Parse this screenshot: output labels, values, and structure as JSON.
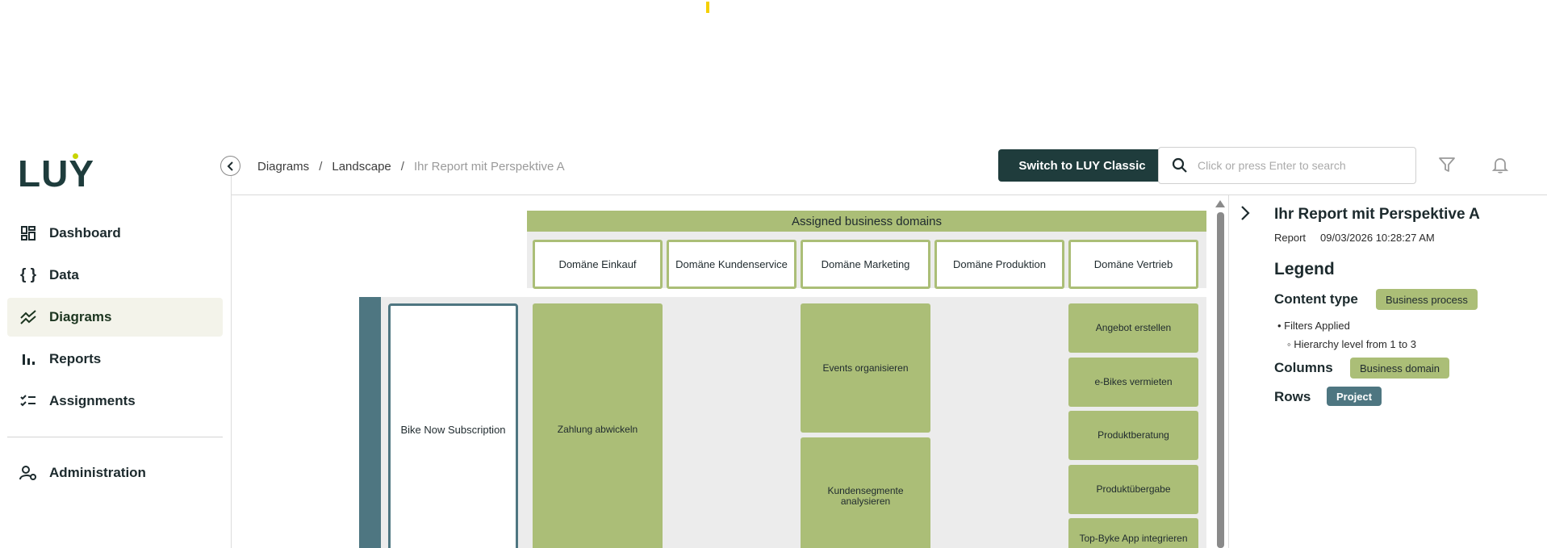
{
  "app": {
    "logo": "LUY",
    "accent": "#1f3c3c",
    "logo_dot_color": "#c8d400"
  },
  "sidebar": {
    "items": [
      {
        "label": "Dashboard",
        "icon": "dashboard-grid-icon",
        "active": false
      },
      {
        "label": "Data",
        "icon": "curly-braces-icon",
        "active": false
      },
      {
        "label": "Diagrams",
        "icon": "trend-chart-icon",
        "active": true
      },
      {
        "label": "Reports",
        "icon": "bar-chart-icon",
        "active": false
      },
      {
        "label": "Assignments",
        "icon": "checklist-icon",
        "active": false
      },
      {
        "label": "Administration",
        "icon": "user-settings-icon",
        "active": false
      }
    ]
  },
  "header": {
    "breadcrumb": [
      "Diagrams",
      "Landscape",
      "Ihr Report mit Perspektive A"
    ],
    "switch_label": "Switch to LUY Classic",
    "search_placeholder": "Click or press Enter to search"
  },
  "diagram": {
    "title": "Assigned business domains",
    "columns": [
      "Domäne Einkauf",
      "Domäne Kundenservice",
      "Domäne Marketing",
      "Domäne Produktion",
      "Domäne Vertrieb"
    ],
    "rows": [
      {
        "label": "Bike Now Subscription",
        "cells": [
          [
            "Zahlung abwickeln"
          ],
          [],
          [
            "Events organisieren",
            "Kundensegmente analysieren"
          ],
          [],
          [
            "Angebot erstellen",
            "e-Bikes vermieten",
            "Produktberatung",
            "Produktübergabe",
            "Top-Byke App integrieren"
          ]
        ]
      }
    ],
    "colors": {
      "content": "#abbe77",
      "row": "#4e7681",
      "background": "#ececec"
    }
  },
  "panel": {
    "title": "Ihr Report mit Perspektive A",
    "meta_type": "Report",
    "meta_date": "09/03/2026 10:28:27 AM",
    "legend_heading": "Legend",
    "content_type_label": "Content type",
    "content_type_value": "Business process",
    "filters_applied": "Filters Applied",
    "filter_detail": "Hierarchy level from 1 to 3",
    "columns_label": "Columns",
    "columns_value": "Business domain",
    "rows_label": "Rows",
    "rows_value": "Project"
  }
}
